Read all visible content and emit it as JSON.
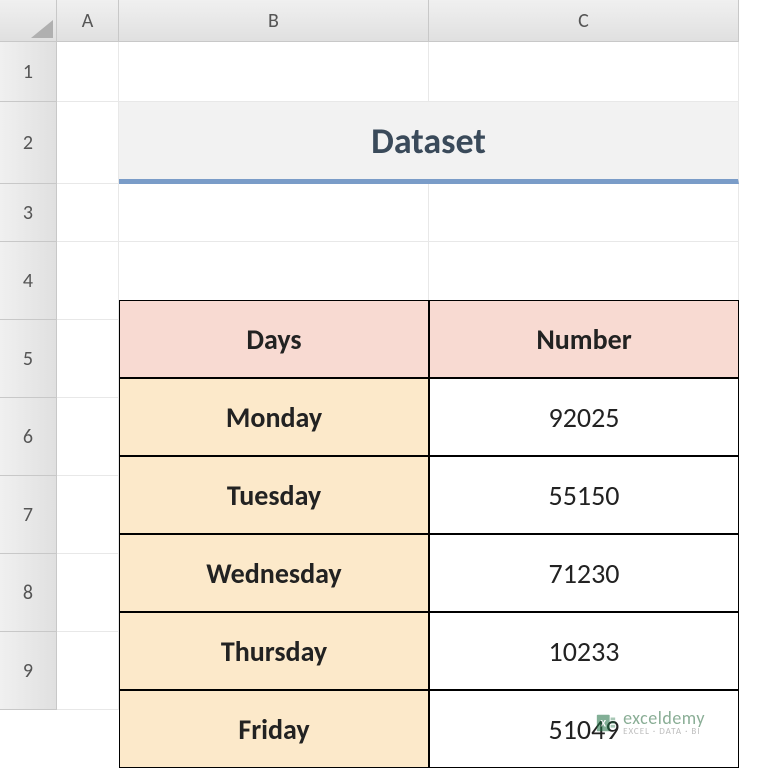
{
  "columns": {
    "A": "A",
    "B": "B",
    "C": "C"
  },
  "rows": {
    "1": "1",
    "2": "2",
    "3": "3",
    "4": "4",
    "5": "5",
    "6": "6",
    "7": "7",
    "8": "8",
    "9": "9"
  },
  "title": "Dataset",
  "headers": {
    "days": "Days",
    "number": "Number"
  },
  "data": [
    {
      "day": "Monday",
      "number": "92025"
    },
    {
      "day": "Tuesday",
      "number": "55150"
    },
    {
      "day": "Wednesday",
      "number": "71230"
    },
    {
      "day": "Thursday",
      "number": "10233"
    },
    {
      "day": "Friday",
      "number": "51049"
    }
  ],
  "watermark": {
    "brand": "exceldemy",
    "tagline": "EXCEL · DATA · BI"
  }
}
